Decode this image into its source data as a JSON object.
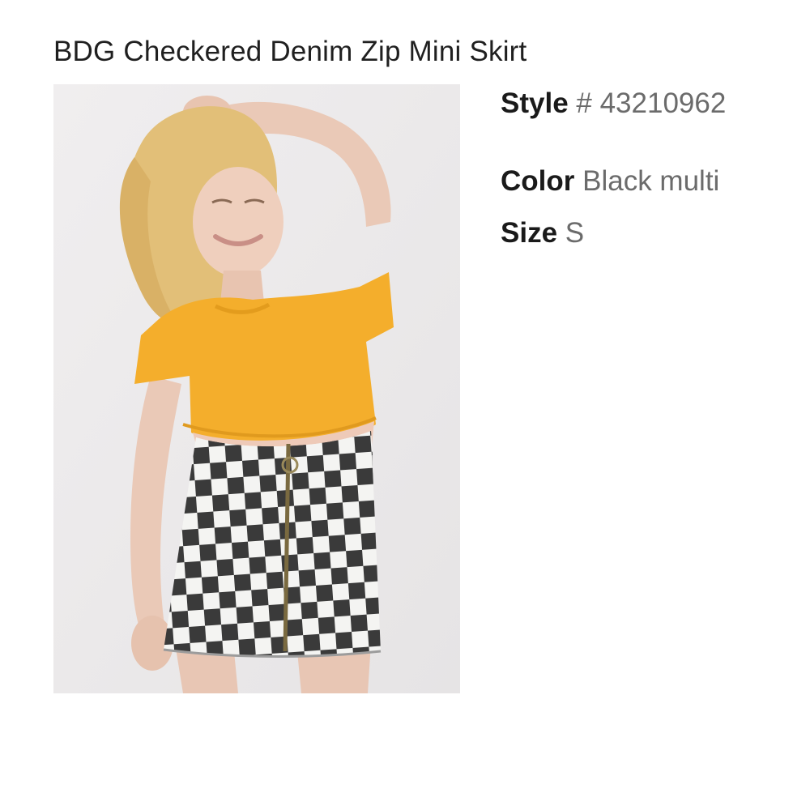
{
  "product": {
    "title": "BDG Checkered Denim Zip Mini Skirt",
    "image_alt": "Model wearing yellow cropped tee and black and white checkered denim zip mini skirt"
  },
  "details": {
    "style_label": "Style",
    "style_value": "# 43210962",
    "color_label": "Color",
    "color_value": "Black multi",
    "size_label": "Size",
    "size_value": "S"
  },
  "colors": {
    "photo_background": "#ebe9ea",
    "tee": "#f4ae2c",
    "skirt_dark": "#3a3a3a",
    "skirt_light": "#f4f4f2",
    "label_text": "#1a1a1a",
    "value_text": "#6b6b6b"
  }
}
